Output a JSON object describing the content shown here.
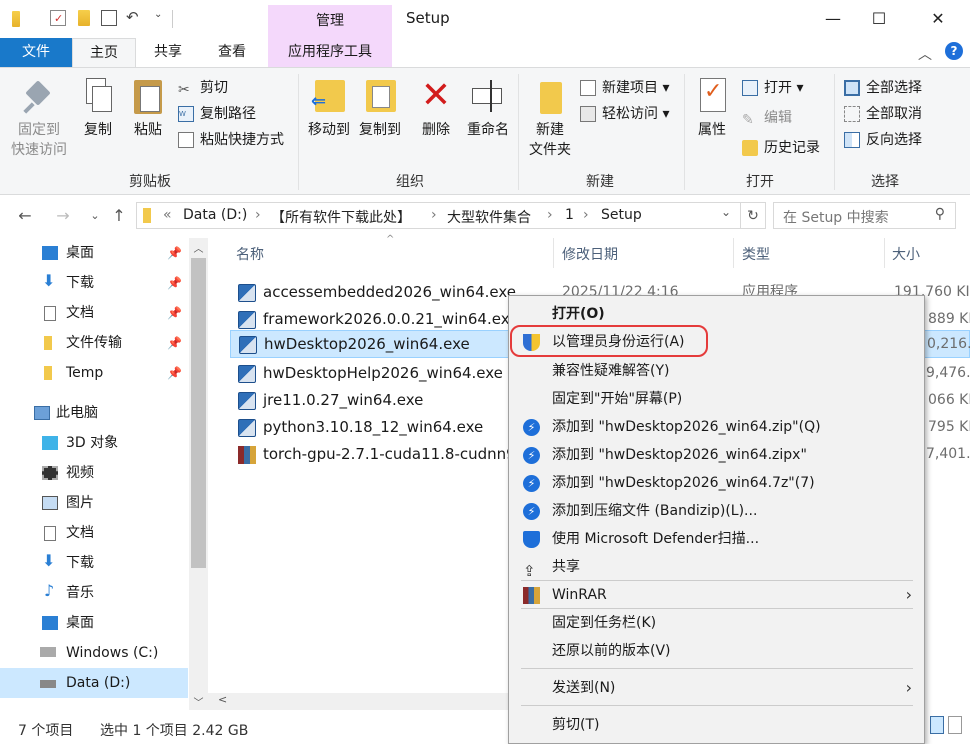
{
  "window": {
    "title": "Setup",
    "contextual_tab_group": "管理",
    "controls": [
      "—",
      "☐",
      "✕"
    ]
  },
  "ribbon_tabs": {
    "file": "文件",
    "home": "主页",
    "share": "共享",
    "view": "查看",
    "app_tools": "应用程序工具"
  },
  "ribbon": {
    "clipboard": {
      "label": "剪贴板",
      "pin": "固定到\n快速访问",
      "copy": "复制",
      "paste": "粘贴",
      "cut": "剪切",
      "copy_path": "复制路径",
      "paste_shortcut": "粘贴快捷方式"
    },
    "organize": {
      "label": "组织",
      "move_to": "移动到",
      "copy_to": "复制到",
      "delete": "删除",
      "rename": "重命名"
    },
    "new": {
      "label": "新建",
      "new_folder": "新建\n文件夹",
      "new_item": "新建项目",
      "easy_access": "轻松访问"
    },
    "open": {
      "label": "打开",
      "properties": "属性",
      "open": "打开",
      "edit": "编辑",
      "history": "历史记录"
    },
    "select": {
      "label": "选择",
      "select_all": "全部选择",
      "select_none": "全部取消",
      "invert": "反向选择"
    }
  },
  "address": {
    "crumbs": [
      "«",
      "Data (D:)",
      "【所有软件下载此处】",
      "大型软件集合",
      "1",
      "Setup"
    ],
    "search_placeholder": "在 Setup 中搜索"
  },
  "nav": {
    "quick": [
      {
        "label": "桌面",
        "pinned": true
      },
      {
        "label": "下载",
        "pinned": true
      },
      {
        "label": "文档",
        "pinned": true
      },
      {
        "label": "文件传输",
        "pinned": true
      },
      {
        "label": "Temp",
        "pinned": true
      }
    ],
    "this_pc": "此电脑",
    "pc_items": [
      "3D 对象",
      "视频",
      "图片",
      "文档",
      "下载",
      "音乐",
      "桌面",
      "Windows (C:)",
      "Data (D:)"
    ]
  },
  "columns": {
    "name": "名称",
    "date": "修改日期",
    "type": "类型",
    "size": "大小"
  },
  "files": [
    {
      "name": "accessembedded2026_win64.exe",
      "date": "2025/11/22 4:16",
      "type": "应用程序",
      "size": "191,760 KI"
    },
    {
      "name": "framework2026.0.0.21_win64.exe",
      "date": "",
      "type": "",
      "size": "889 KI"
    },
    {
      "name": "hwDesktop2026_win64.exe",
      "date": "",
      "type": "",
      "size": "0,216..."
    },
    {
      "name": "hwDesktopHelp2026_win64.exe",
      "date": "",
      "type": "",
      "size": "9,476..."
    },
    {
      "name": "jre11.0.27_win64.exe",
      "date": "",
      "type": "",
      "size": "066 KI"
    },
    {
      "name": "python3.10.18_12_win64.exe",
      "date": "",
      "type": "",
      "size": "795 KI"
    },
    {
      "name": "torch-gpu-2.7.1-cuda11.8-cudnn9",
      "date": "",
      "type": "",
      "size": "7,401..."
    }
  ],
  "status": {
    "count": "7 个项目",
    "selection": "选中 1 个项目  2.42 GB"
  },
  "context_menu": {
    "open": "打开(O)",
    "run_as_admin": "以管理员身份运行(A)",
    "compat": "兼容性疑难解答(Y)",
    "pin_start": "固定到\"开始\"屏幕(P)",
    "add_zip": "添加到 \"hwDesktop2026_win64.zip\"(Q)",
    "add_zipx": "添加到 \"hwDesktop2026_win64.zipx\"",
    "add_7z": "添加到 \"hwDesktop2026_win64.7z\"(7)",
    "add_bandizip": "添加到压缩文件 (Bandizip)(L)...",
    "defender": "使用 Microsoft Defender扫描...",
    "share": "共享",
    "winrar": "WinRAR",
    "pin_taskbar": "固定到任务栏(K)",
    "restore": "还原以前的版本(V)",
    "send_to": "发送到(N)",
    "cut": "剪切(T)"
  }
}
